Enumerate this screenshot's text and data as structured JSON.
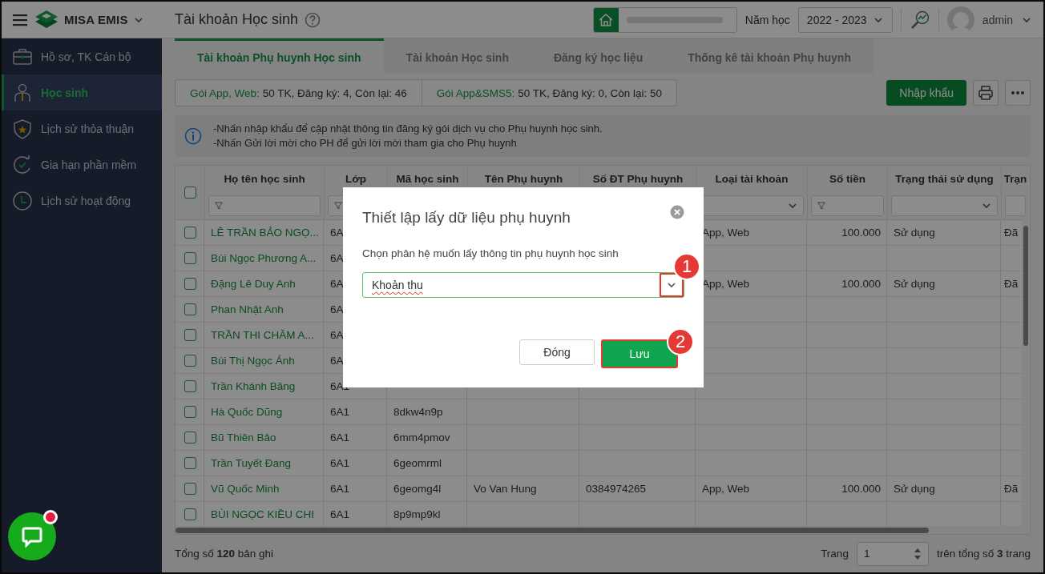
{
  "topbar": {
    "app_name": "MISA EMIS",
    "page_title": "Tài khoản Học sinh",
    "year_label": "Năm học",
    "year": "2022 - 2023",
    "user": "admin"
  },
  "sidebar": {
    "items": [
      {
        "label": "Hồ sơ, TK Cán bộ",
        "selected": false
      },
      {
        "label": "Học sinh",
        "selected": true
      },
      {
        "label": "Lịch sử thỏa thuận",
        "selected": false
      },
      {
        "label": "Gia hạn phần mềm",
        "selected": false
      },
      {
        "label": "Lịch sử hoạt động",
        "selected": false
      }
    ]
  },
  "tabs": [
    {
      "label": "Tài khoản Phụ huynh Học sinh",
      "selected": true
    },
    {
      "label": "Tài khoản Học sinh",
      "selected": false
    },
    {
      "label": "Đăng ký học liệu",
      "selected": false
    },
    {
      "label": "Thống kê tài khoản Phụ huynh",
      "selected": false
    }
  ],
  "packages": [
    {
      "label": "Gói App, Web:",
      "value": "50 TK, Đăng ký: 4, Còn lại: 46"
    },
    {
      "label": "Gói App&SMS5:",
      "value": "50 TK, Đăng ký: 0, Còn lại: 50"
    }
  ],
  "toolbar": {
    "import_button": "Nhập khẩu"
  },
  "notice": {
    "lines": [
      "-Nhấn nhập khẩu để cập nhật thông tin đăng ký gói dịch vụ cho Phụ huynh học sinh.",
      "-Nhấn Gửi lời mời cho PH để gửi lời mời tham gia cho Phụ huynh"
    ]
  },
  "table": {
    "select_all": {
      "checked": false
    },
    "columns": [
      {
        "title": "Họ tên học sinh",
        "kind": "link",
        "filter": {
          "kind": "text"
        }
      },
      {
        "title": "Lớp",
        "kind": "text",
        "filter": {
          "kind": "text"
        }
      },
      {
        "title": "Mã học sinh",
        "kind": "text"
      },
      {
        "title": "Tên Phụ huynh",
        "kind": "text"
      },
      {
        "title": "Số ĐT Phụ huynh",
        "kind": "text"
      },
      {
        "title": "Loại tài khoản",
        "kind": "text",
        "filter": {
          "kind": "select"
        }
      },
      {
        "title": "Số tiền",
        "kind": "number",
        "filter": {
          "kind": "text"
        }
      },
      {
        "title": "Trạng thái sử dụng",
        "kind": "text",
        "filter": {
          "kind": "select"
        }
      },
      {
        "title": "Trạn",
        "kind": "text",
        "filter": {
          "kind": "plain"
        }
      }
    ],
    "rows": [
      {
        "checked": false,
        "cells": [
          "LÊ TRẦN BẢO NGỌ...",
          "6A",
          null,
          null,
          null,
          "App, Web",
          "100.000",
          "Sử dụng",
          "Đã"
        ]
      },
      {
        "checked": false,
        "cells": [
          "Bùi Ngọc Phương A...",
          "6A"
        ]
      },
      {
        "checked": false,
        "cells": [
          "Đặng Lê Duy Anh",
          "6A",
          null,
          null,
          null,
          "App, Web",
          "100.000",
          "Sử dụng",
          "Đã"
        ]
      },
      {
        "checked": false,
        "cells": [
          "Phan Nhật Anh",
          "6A"
        ]
      },
      {
        "checked": false,
        "cells": [
          "TRẦN THI CHĂM A...",
          "6A"
        ]
      },
      {
        "checked": false,
        "cells": [
          "Bùi Thị Ngọc Ánh",
          "6A"
        ]
      },
      {
        "checked": false,
        "cells": [
          "Trần Khánh Băng",
          "6A1"
        ]
      },
      {
        "checked": false,
        "cells": [
          "Hà Quốc Dũng",
          "6A1",
          "8dkw4n9p"
        ]
      },
      {
        "checked": false,
        "cells": [
          "Bũ Thiên Bảo",
          "6A1",
          "6mm4pmov"
        ]
      },
      {
        "checked": false,
        "cells": [
          "Trần Tuyết Đang",
          "6A1",
          "6geomrml"
        ]
      },
      {
        "checked": false,
        "cells": [
          "Vũ Quốc Minh",
          "6A1",
          "6geomg4l",
          "Vo Van Hung",
          "0384974265",
          "App, Web",
          "100.000",
          "Sử dụng",
          "Đã"
        ]
      },
      {
        "checked": false,
        "cells": [
          "BÙI NGỌC KIỀU CHI",
          "6A1",
          "8p9mp9kl"
        ]
      }
    ]
  },
  "footer": {
    "total": "Tổng số **120** bản ghi",
    "page_label": "Trang",
    "page": "1",
    "pages": "trên tổng số **3** trang"
  },
  "dialog": {
    "title": "Thiết lập lấy dữ liệu phụ huynh",
    "prompt": "Chọn phân hệ muốn lấy thông tin phụ huynh học sinh",
    "select": {
      "value": "Khoản thu",
      "callout": "1"
    },
    "buttons": [
      {
        "label": "Đóng",
        "kind": "secondary"
      },
      {
        "label": "Lưu",
        "kind": "primary",
        "callout": "2"
      }
    ]
  },
  "chat": {
    "unread": true
  }
}
